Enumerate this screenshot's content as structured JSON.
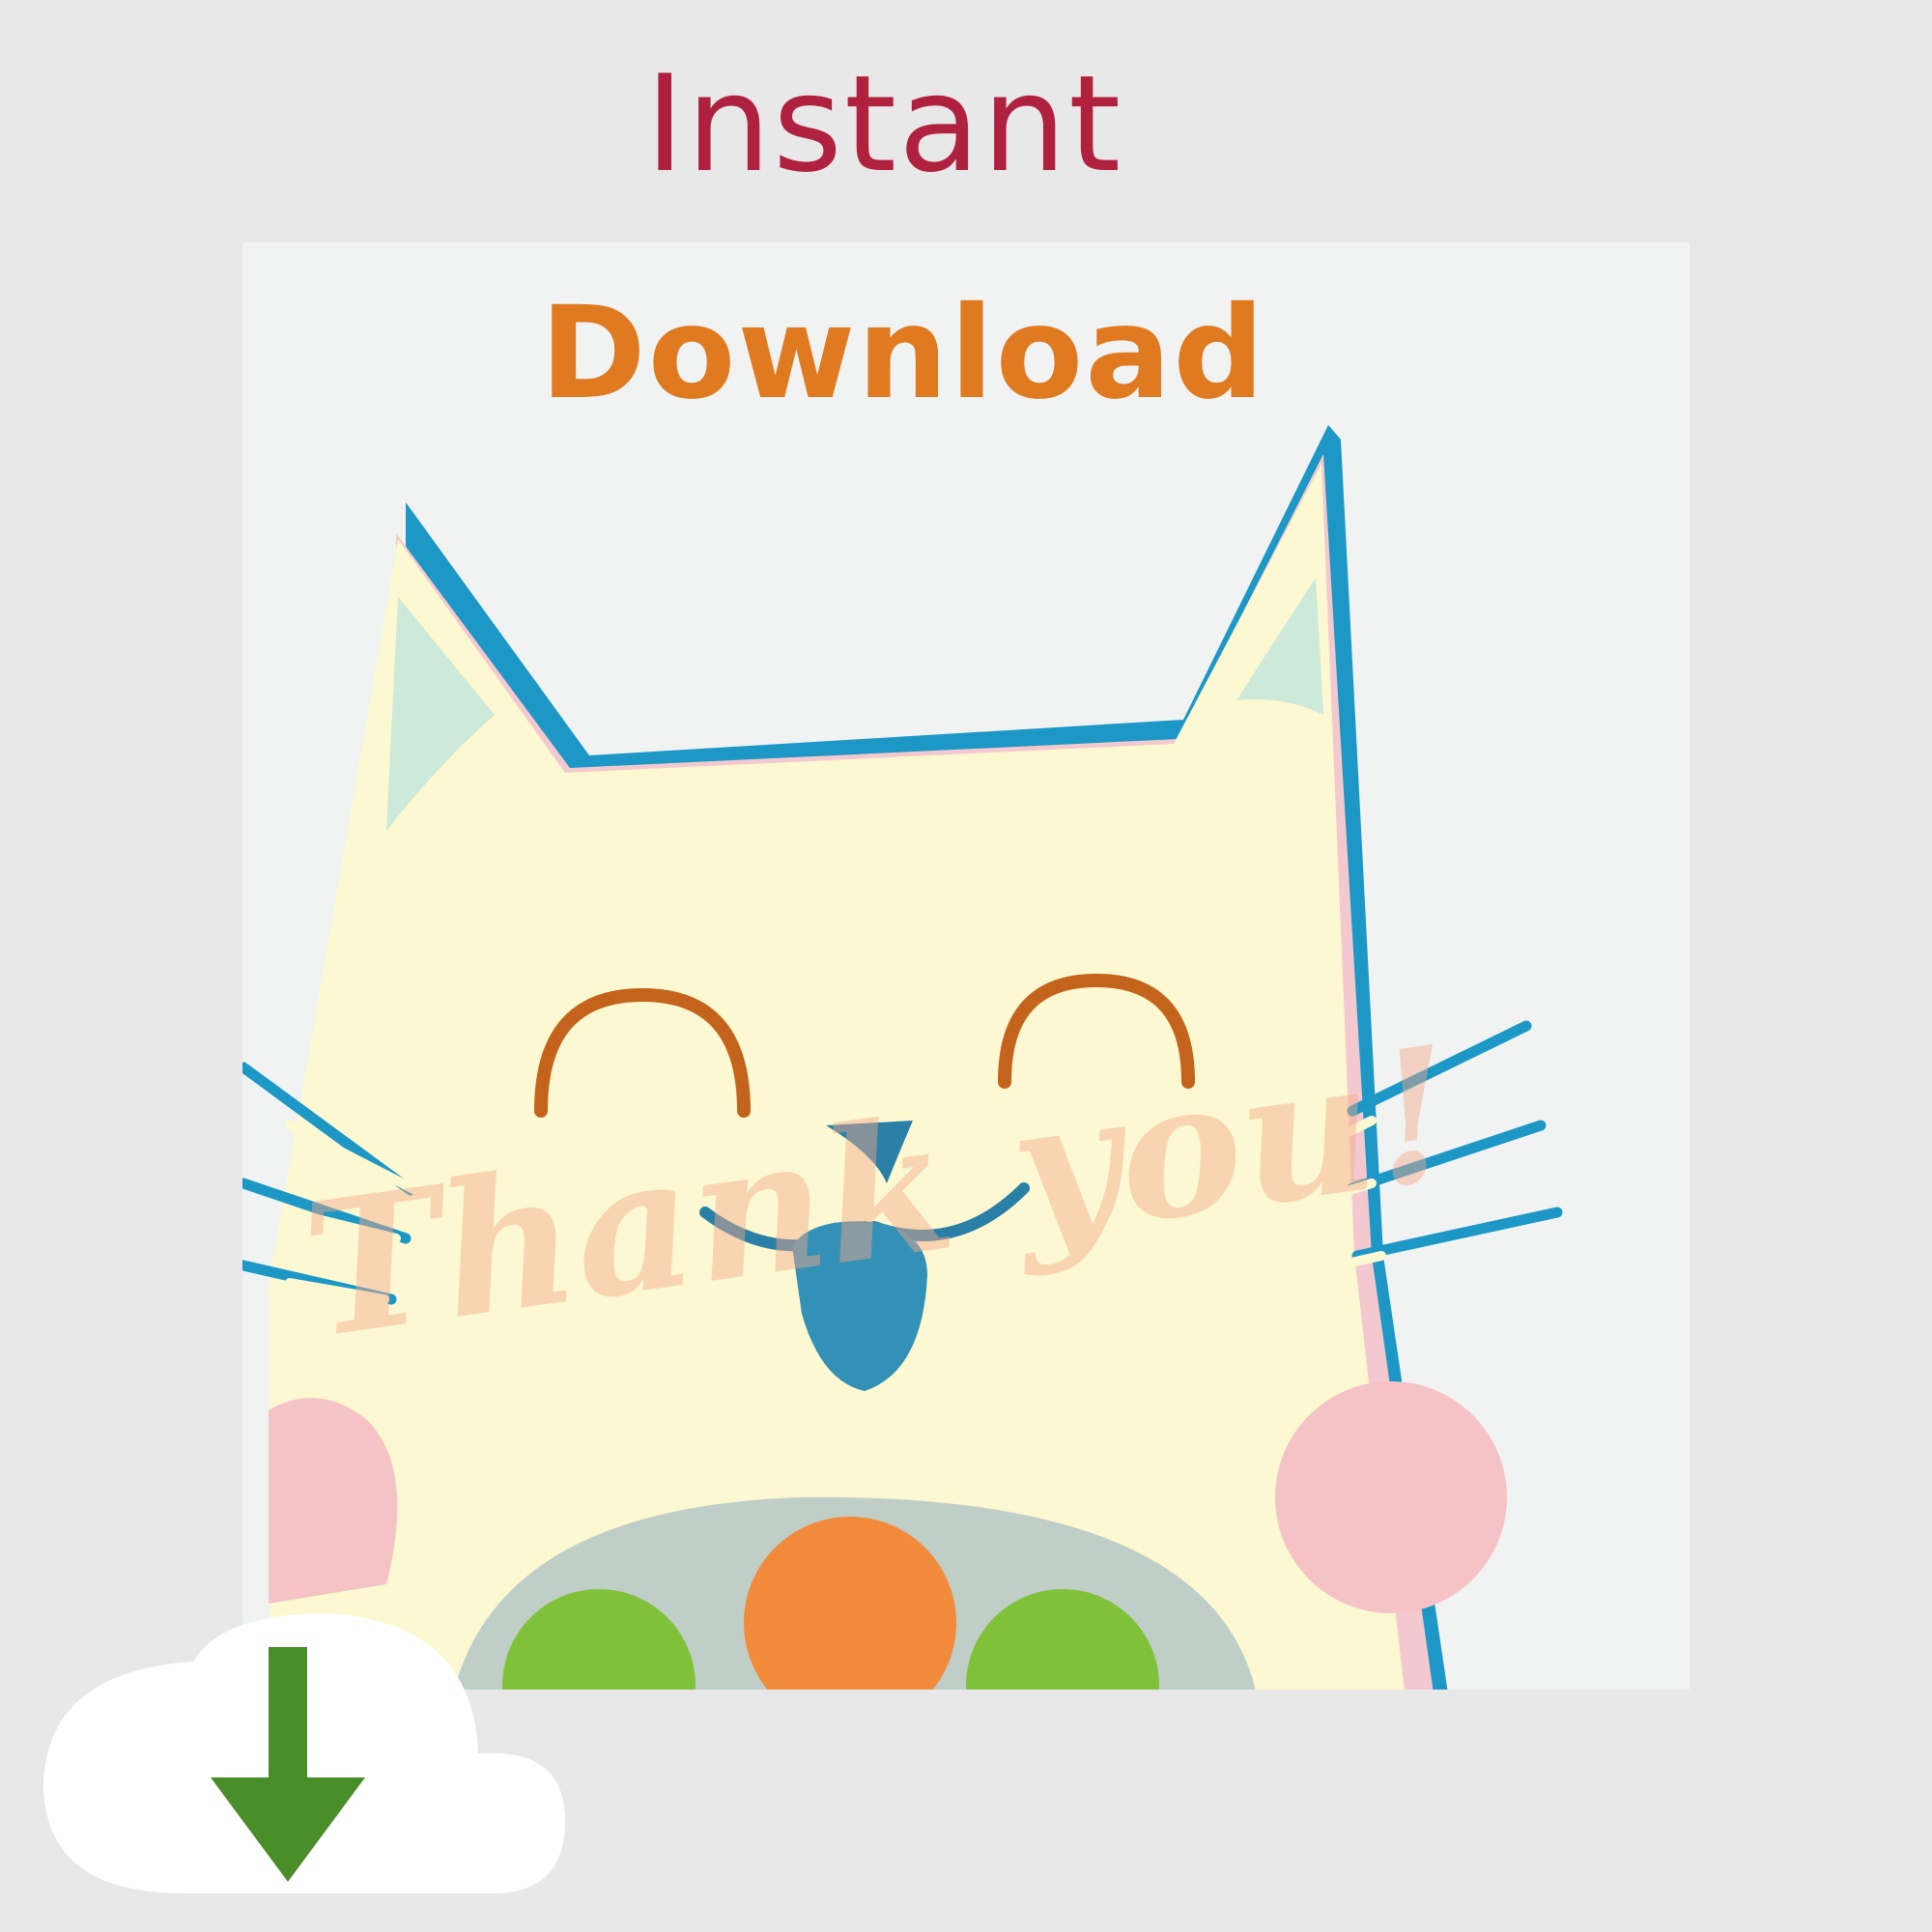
{
  "header": {
    "line1": "Instant",
    "line2": "Download"
  },
  "card": {
    "message": "Thank you!"
  },
  "colors": {
    "background": "#e7e8e7",
    "instant": "#b0213f",
    "download": "#e07a20",
    "cat_face": "#fbf8d2",
    "cat_outline": "#1d98c6",
    "cheek": "#f5c3c6",
    "ear_inner": "#cde9d9",
    "eye": "#c4641c",
    "arrow": "#4a8e2a"
  },
  "icons": {
    "cloud": "cloud-download-icon"
  }
}
